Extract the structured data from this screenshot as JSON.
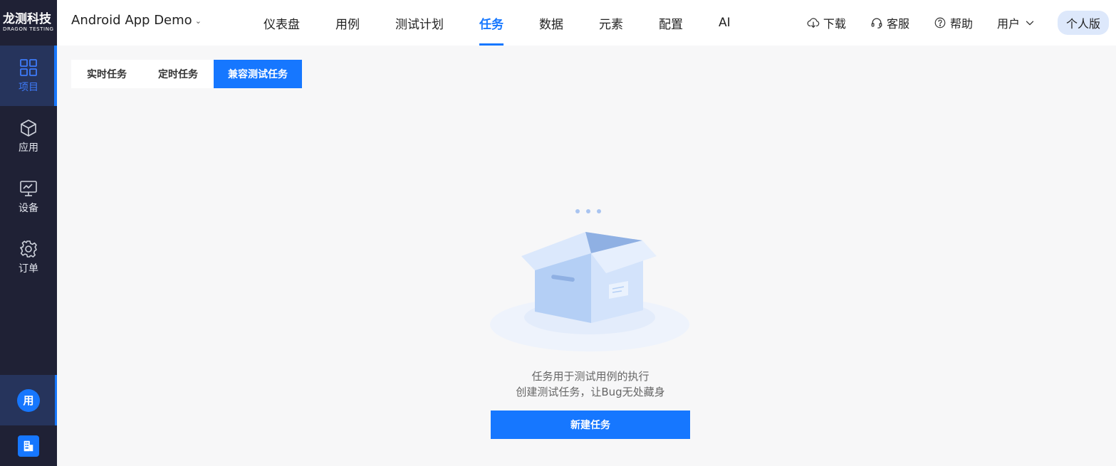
{
  "logo": {
    "cn": "龙测科技",
    "en": "DRAGON TESTING"
  },
  "sidebar": {
    "items": [
      {
        "label": "项目",
        "icon": "grid-icon",
        "active": true
      },
      {
        "label": "应用",
        "icon": "cube-icon",
        "active": false
      },
      {
        "label": "设备",
        "icon": "monitor-icon",
        "active": false
      },
      {
        "label": "订单",
        "icon": "gear-icon",
        "active": false
      }
    ],
    "user_avatar": "用",
    "org_icon": "building-icon"
  },
  "header": {
    "project": "Android App Demo",
    "tabs": [
      "仪表盘",
      "用例",
      "测试计划",
      "任务",
      "数据",
      "元素",
      "配置",
      "AI"
    ],
    "active_tab": "任务",
    "tools": {
      "download": "下载",
      "support": "客服",
      "help": "帮助",
      "user": "用户"
    },
    "edition": "个人版"
  },
  "subtabs": [
    "实时任务",
    "定时任务",
    "兼容测试任务"
  ],
  "active_subtab": "兼容测试任务",
  "empty_state": {
    "line1": "任务用于测试用例的执行",
    "line2": "创建测试任务，让Bug无处藏身",
    "button": "新建任务"
  },
  "colors": {
    "accent": "#1677ff",
    "sidebar_bg": "#1f2135",
    "sidebar_active_bg": "#26345c",
    "edition_bg": "#dde8fb"
  }
}
